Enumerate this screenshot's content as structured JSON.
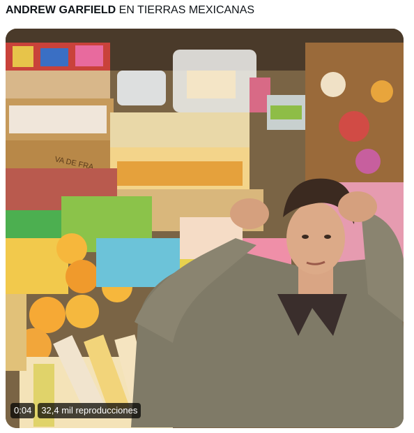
{
  "tweet": {
    "caption_bold": "ANDREW GARFIELD",
    "caption_rest": " EN TIERRAS MEXICANAS"
  },
  "video": {
    "timestamp": "0:04",
    "views": "32,4 mil reproducciones",
    "sign_text": "VA DE FRA"
  }
}
